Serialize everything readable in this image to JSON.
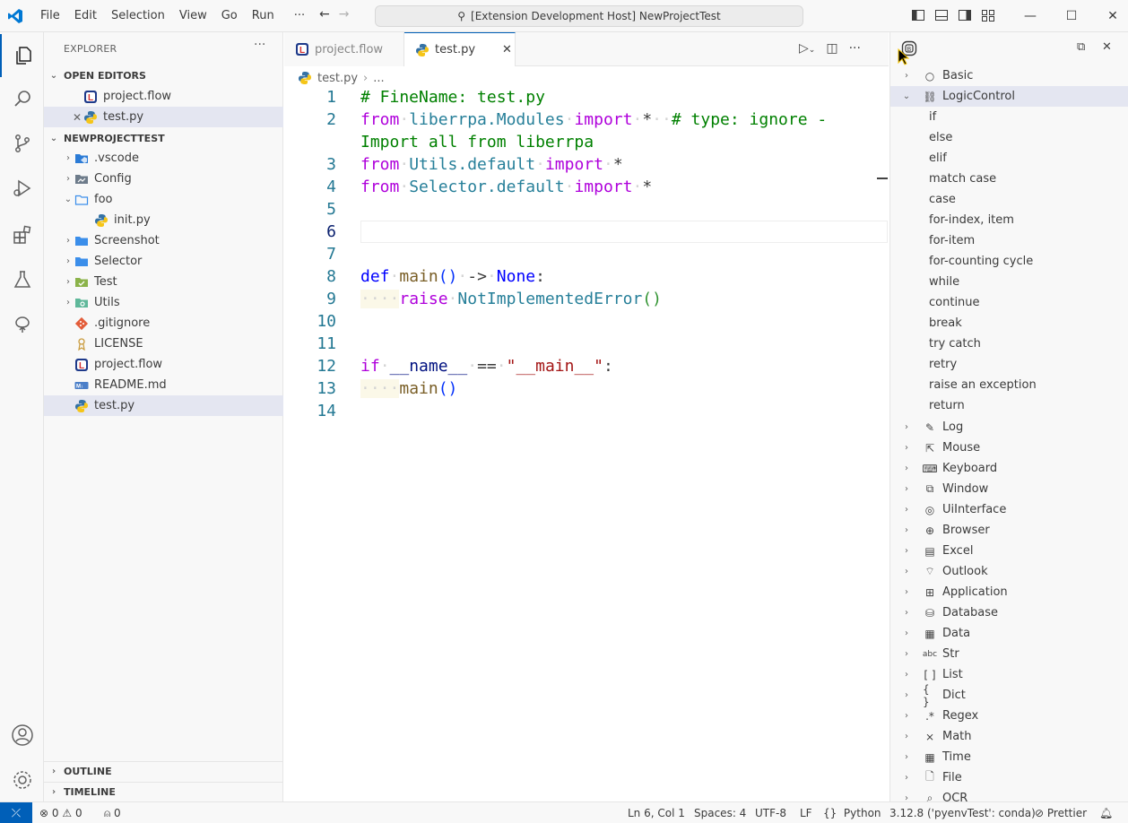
{
  "titlebar": {
    "menu": [
      "File",
      "Edit",
      "Selection",
      "View",
      "Go",
      "Run",
      "···"
    ],
    "command_center": "[Extension Development Host] NewProjectTest"
  },
  "sidebar": {
    "title": "EXPLORER",
    "open_editors_label": "OPEN EDITORS",
    "open_editors": [
      {
        "label": "project.flow",
        "icon": "flow-file-icon"
      },
      {
        "label": "test.py",
        "icon": "python-file-icon"
      }
    ],
    "project_label": "NEWPROJECTTEST",
    "tree": [
      {
        "label": ".vscode",
        "icon": "vscode-folder-icon"
      },
      {
        "label": "Config",
        "icon": "config-folder-icon"
      },
      {
        "label": "foo",
        "icon": "folder-open-icon"
      },
      {
        "label": "init.py",
        "icon": "python-file-icon"
      },
      {
        "label": "Screenshot",
        "icon": "folder-icon"
      },
      {
        "label": "Selector",
        "icon": "folder-icon"
      },
      {
        "label": "Test",
        "icon": "test-folder-icon"
      },
      {
        "label": "Utils",
        "icon": "utils-folder-icon"
      },
      {
        "label": ".gitignore",
        "icon": "git-icon"
      },
      {
        "label": "LICENSE",
        "icon": "license-icon"
      },
      {
        "label": "project.flow",
        "icon": "flow-file-icon"
      },
      {
        "label": "README.md",
        "icon": "markdown-icon"
      },
      {
        "label": "test.py",
        "icon": "python-file-icon"
      }
    ],
    "outline_label": "OUTLINE",
    "timeline_label": "TIMELINE"
  },
  "editor": {
    "tabs": [
      {
        "label": "project.flow",
        "icon": "flow-file-icon"
      },
      {
        "label": "test.py",
        "icon": "python-file-icon"
      }
    ],
    "breadcrumb": [
      "test.py",
      "..."
    ],
    "line_numbers": [
      "1",
      "2",
      "",
      "3",
      "4",
      "5",
      "6",
      "7",
      "8",
      "9",
      "10",
      "11",
      "12",
      "13",
      "14"
    ]
  },
  "rightpanel": {
    "basic": "Basic",
    "logic": "LogicControl",
    "logic_children": [
      "if",
      "else",
      "elif",
      "match case",
      "case",
      "for-index, item",
      "for-item",
      "for-counting cycle",
      "while",
      "continue",
      "break",
      "try catch",
      "retry",
      "raise an exception",
      "return"
    ],
    "categories": [
      {
        "label": "Log",
        "icon": "pencil-icon"
      },
      {
        "label": "Mouse",
        "icon": "mouse-icon"
      },
      {
        "label": "Keyboard",
        "icon": "keyboard-icon"
      },
      {
        "label": "Window",
        "icon": "window-icon"
      },
      {
        "label": "UiInterface",
        "icon": "target-icon"
      },
      {
        "label": "Browser",
        "icon": "globe-icon"
      },
      {
        "label": "Excel",
        "icon": "excel-icon"
      },
      {
        "label": "Outlook",
        "icon": "outlook-icon"
      },
      {
        "label": "Application",
        "icon": "application-icon"
      },
      {
        "label": "Database",
        "icon": "database-icon"
      },
      {
        "label": "Data",
        "icon": "data-icon"
      },
      {
        "label": "Str",
        "icon": "abc-icon"
      },
      {
        "label": "List",
        "icon": "brackets-icon"
      },
      {
        "label": "Dict",
        "icon": "braces-icon"
      },
      {
        "label": "Regex",
        "icon": "regex-icon"
      },
      {
        "label": "Math",
        "icon": "math-icon"
      },
      {
        "label": "Time",
        "icon": "calendar-icon"
      },
      {
        "label": "File",
        "icon": "file-icon"
      },
      {
        "label": "OCR",
        "icon": "search-icon"
      }
    ]
  },
  "statusbar": {
    "errors": "0",
    "warnings": "0",
    "ports": "0",
    "position": "Ln 6, Col 1",
    "spaces": "Spaces: 4",
    "encoding": "UTF-8",
    "eol": "LF",
    "language": "Python",
    "interpreter": "3.12.8 ('pyenvTest': conda)",
    "prettier": "Prettier"
  }
}
